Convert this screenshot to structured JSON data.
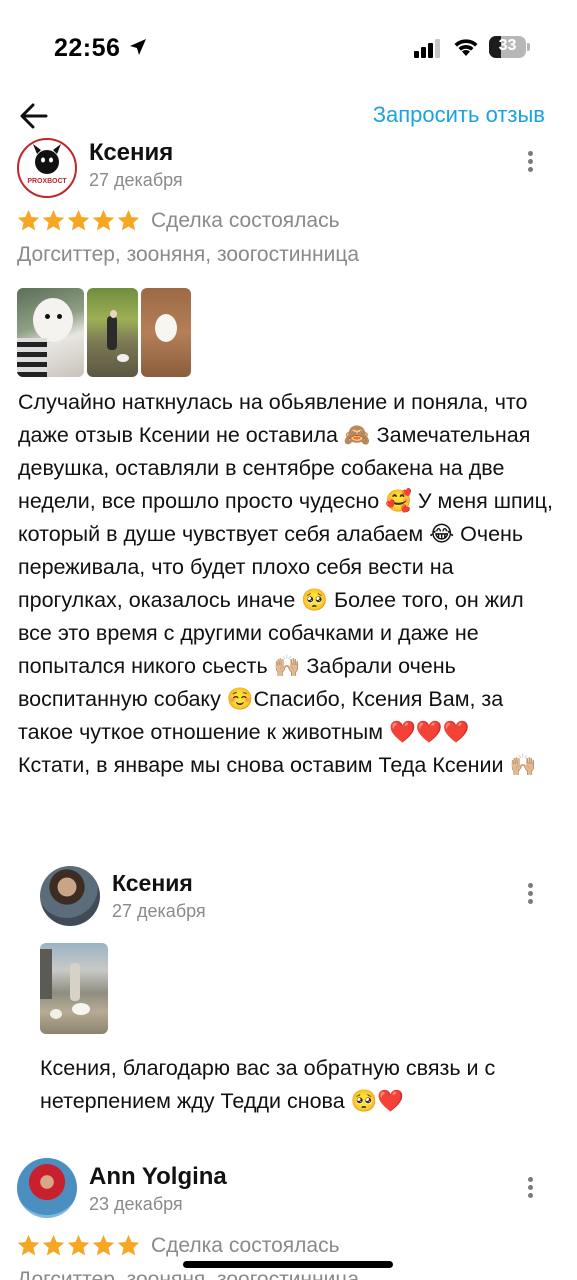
{
  "status_bar": {
    "time": "22:56",
    "battery": "33"
  },
  "header": {
    "request_review": "Запросить отзыв"
  },
  "review1": {
    "author": "Ксения",
    "date": "27 декабря",
    "rating": 5,
    "deal_status": "Сделка состоялась",
    "category": "Догситтер, зооняня, зоогостинница",
    "avatar_logo": "PROХВОСТ",
    "text": "Случайно наткнулась на обьявление и поняла, что даже отзыв Ксении не оставила 🙈 Замечательная  девушка, оставляли  в сентябре собакена на две недели, все прошло просто чудесно 🥰 У меня шпиц, который в душе чувствует себя алабаем 😂 Очень переживала, что будет плохо себя вести на прогулках, оказалось иначе 🥺 Более того, он жил все это время с другими собачками и даже не попытался никого сьесть 🙌🏼 Забрали очень воспитанную собаку ☺️Спасибо, Ксения Вам, за такое чуткое отношение к животным ❤️❤️❤️\nКстати, в январе мы снова оставим Теда Ксении 🙌🏼"
  },
  "reply": {
    "author": "Ксения",
    "date": "27 декабря",
    "text": "Ксения, благодарю вас за обратную связь и с нетерпением жду Тедди снова 🥺❤️"
  },
  "review2": {
    "author": "Ann Yolgina",
    "date": "23 декабря",
    "rating": 5,
    "deal_status": "Сделка состоялась",
    "category": "Догситтер, зооняня, зоогостинница"
  },
  "colors": {
    "accent": "#1aa3e0",
    "star": "#f5a623",
    "muted": "#8a8a8a",
    "heart": "#d9162b"
  }
}
